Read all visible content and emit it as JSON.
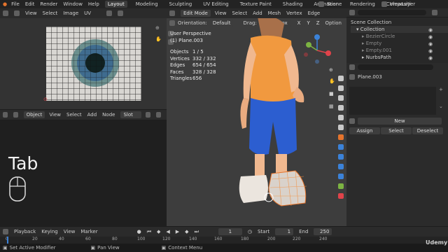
{
  "topbar": {
    "menus": [
      "File",
      "Edit",
      "Render",
      "Window",
      "Help"
    ],
    "workspaces": [
      "Layout",
      "Modeling",
      "Sculpting",
      "UV Editing",
      "Texture Paint",
      "Shading",
      "Animation",
      "Rendering",
      "Compositi"
    ],
    "active_workspace": "Layout",
    "scene": "Scene",
    "view_layer": "ViewLayer"
  },
  "image_editor": {
    "menus": [
      "View",
      "Select",
      "Image",
      "UV"
    ]
  },
  "viewport": {
    "mode": "Edit Mode",
    "menus": [
      "View",
      "Select",
      "Add",
      "Mesh",
      "Vertex",
      "Edge"
    ],
    "orientation_label": "Orientation:",
    "orientation_value": "Default",
    "drag_label": "Drag:",
    "drag_value": "Select Box",
    "axes": [
      "X",
      "Y",
      "Z"
    ],
    "options": "Option",
    "perspective": "User Perspective",
    "object_name": "(1) Plane.003",
    "stats": [
      {
        "label": "Objects",
        "value": "1 / 5"
      },
      {
        "label": "Vertices",
        "value": "332 / 332"
      },
      {
        "label": "Edges",
        "value": "654 / 654"
      },
      {
        "label": "Faces",
        "value": "328 / 328"
      },
      {
        "label": "Triangles",
        "value": "656"
      }
    ],
    "overlay_key": "Tab"
  },
  "node_editor": {
    "object_value": "Object",
    "menus": [
      "View",
      "Select",
      "Add",
      "Node"
    ],
    "slot_value": "Slot"
  },
  "outliner": {
    "root": "Scene Collection",
    "items": [
      {
        "label": "Collection",
        "level": 0
      },
      {
        "label": "BezierCircle",
        "level": 1
      },
      {
        "label": "Empty",
        "level": 1
      },
      {
        "label": "Empty.001",
        "level": 1
      },
      {
        "label": "NurbsPath",
        "level": 1
      }
    ]
  },
  "properties": {
    "object_name": "Plane.003",
    "new_button": "New",
    "assign_button": "Assign",
    "select_button": "Select",
    "deselect_button": "Deselect"
  },
  "timeline": {
    "menus": [
      "Playback",
      "Keying",
      "View",
      "Marker"
    ],
    "current_frame": "1",
    "start_label": "Start",
    "start_value": "1",
    "end_label": "End",
    "end_value": "250",
    "ruler": [
      "0",
      "20",
      "40",
      "60",
      "80",
      "100",
      "120",
      "140",
      "160",
      "180",
      "200",
      "220",
      "240"
    ]
  },
  "statusbar": {
    "items": [
      "Set Active Modifier",
      "Pan View",
      "Context Menu"
    ],
    "watermark": "Udemy"
  },
  "colors": {
    "accent": "#e5742d",
    "shirt": "#f1993f",
    "pants": "#2c5ed0",
    "x_axis": "#e0434a",
    "y_axis": "#7cb342",
    "z_axis": "#3b82d8"
  }
}
